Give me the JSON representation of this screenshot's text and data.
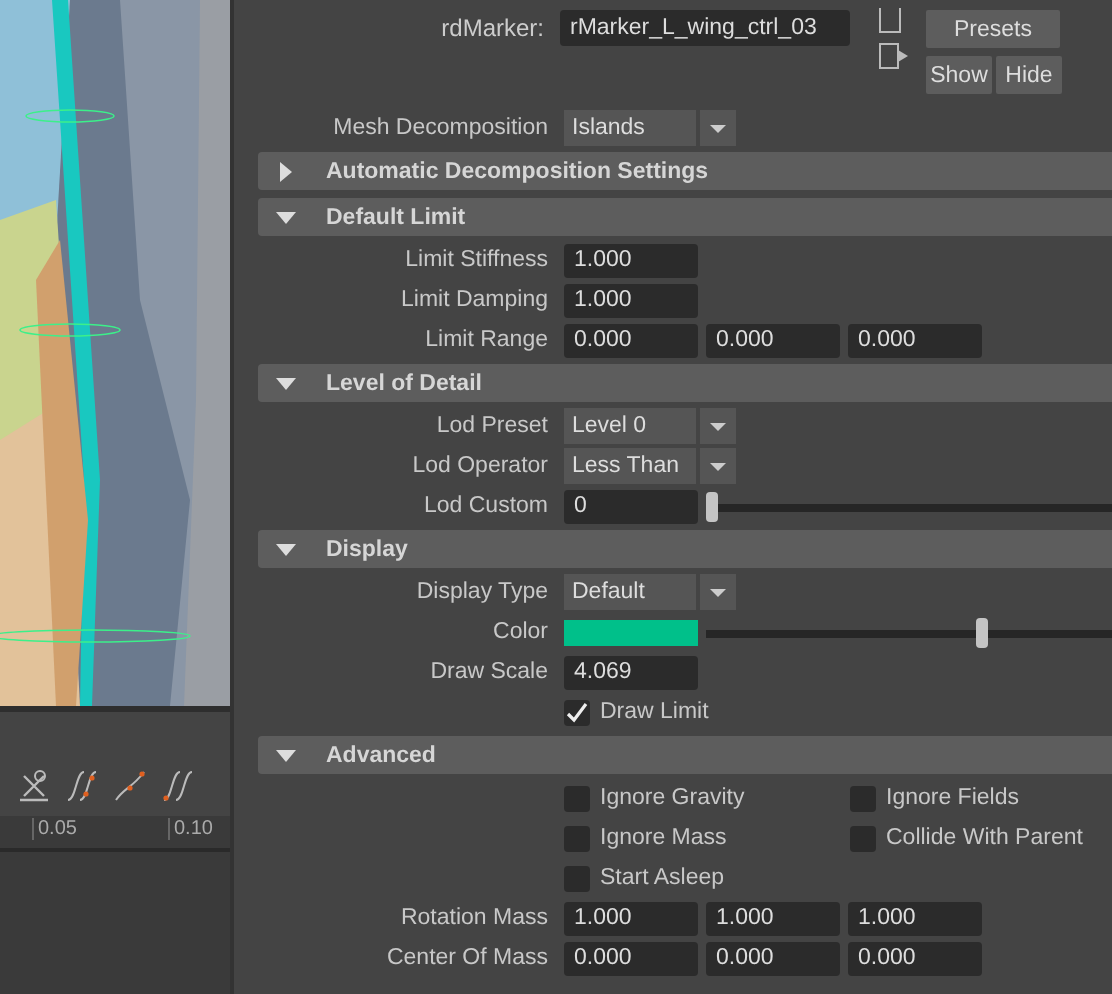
{
  "timeline": {
    "ticks": [
      "0.05",
      "0.10"
    ]
  },
  "node": {
    "label": "rdMarker:",
    "name": "rMarker_L_wing_ctrl_03",
    "presets": "Presets",
    "show": "Show",
    "hide": "Hide"
  },
  "top_rows": [
    {
      "kind": "dropdown",
      "label": "Mesh Decomposition",
      "value": "Islands"
    }
  ],
  "sections": [
    {
      "title": "Automatic Decomposition Settings",
      "expanded": false
    },
    {
      "title": "Default Limit",
      "expanded": true,
      "rows": [
        {
          "kind": "fields",
          "label": "Limit Stiffness",
          "values": [
            "1.000"
          ]
        },
        {
          "kind": "fields",
          "label": "Limit Damping",
          "values": [
            "1.000"
          ]
        },
        {
          "kind": "fields",
          "label": "Limit Range",
          "values": [
            "0.000",
            "0.000",
            "0.000"
          ]
        }
      ]
    },
    {
      "title": "Level of Detail",
      "expanded": true,
      "rows": [
        {
          "kind": "dropdown",
          "label": "Lod Preset",
          "value": "Level 0"
        },
        {
          "kind": "dropdown",
          "label": "Lod Operator",
          "value": "Less Than"
        },
        {
          "kind": "slider",
          "label": "Lod Custom",
          "value": "0",
          "level": 0
        }
      ]
    },
    {
      "title": "Display",
      "expanded": true,
      "rows": [
        {
          "kind": "dropdown",
          "label": "Display Type",
          "value": "Default"
        },
        {
          "kind": "color",
          "label": "Color",
          "color": "#00c08a",
          "level": 0.71
        },
        {
          "kind": "fields",
          "label": "Draw Scale",
          "values": [
            "4.069"
          ]
        },
        {
          "kind": "checks",
          "items": [
            {
              "label": "Draw Limit",
              "checked": true
            }
          ]
        }
      ]
    },
    {
      "title": "Advanced",
      "expanded": true,
      "rows": [
        {
          "kind": "checks",
          "items": [
            {
              "label": "Ignore Gravity",
              "checked": false
            },
            {
              "label": "Ignore Fields",
              "checked": false
            }
          ]
        },
        {
          "kind": "checks",
          "items": [
            {
              "label": "Ignore Mass",
              "checked": false
            },
            {
              "label": "Collide With Parent",
              "checked": false
            }
          ]
        },
        {
          "kind": "checks",
          "items": [
            {
              "label": "Start Asleep",
              "checked": false
            }
          ]
        },
        {
          "kind": "fields",
          "label": "Rotation Mass",
          "values": [
            "1.000",
            "1.000",
            "1.000"
          ]
        },
        {
          "kind": "fields",
          "label": "Center Of Mass",
          "values": [
            "0.000",
            "0.000",
            "0.000"
          ]
        }
      ]
    }
  ]
}
